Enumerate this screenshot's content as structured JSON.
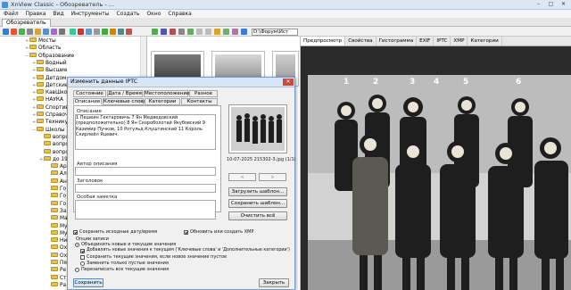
{
  "window": {
    "title": "XnView Classic - Обозреватель - ..."
  },
  "menu": [
    "Файл",
    "Правка",
    "Вид",
    "Инструменты",
    "Создать",
    "Окно",
    "Справка"
  ],
  "doc_tab": "Обозреватель",
  "path_field": "D:\\Форум\\Ист",
  "tree": [
    {
      "indent": 3,
      "exp": "+",
      "label": "Мосты"
    },
    {
      "indent": 3,
      "exp": "+",
      "label": "Область"
    },
    {
      "indent": 3,
      "exp": "−",
      "label": "Образование"
    },
    {
      "indent": 4,
      "exp": "+",
      "label": "Водный"
    },
    {
      "indent": 4,
      "exp": "+",
      "label": "Высшие"
    },
    {
      "indent": 4,
      "exp": "+",
      "label": "Детдом"
    },
    {
      "indent": 4,
      "exp": "+",
      "label": "Детские"
    },
    {
      "indent": 4,
      "exp": "+",
      "label": "КавШкол"
    },
    {
      "indent": 4,
      "exp": "+",
      "label": "НАУКА"
    },
    {
      "indent": 4,
      "exp": "+",
      "label": "Спортив"
    },
    {
      "indent": 4,
      "exp": "+",
      "label": "Справоч"
    },
    {
      "indent": 4,
      "exp": "+",
      "label": "Техникум"
    },
    {
      "indent": 4,
      "exp": "−",
      "label": "Школы"
    },
    {
      "indent": 5,
      "exp": "",
      "label": "вопрос"
    },
    {
      "indent": 5,
      "exp": "",
      "label": "вопрос"
    },
    {
      "indent": 5,
      "exp": "",
      "label": "вопрос"
    },
    {
      "indent": 5,
      "exp": "+",
      "label": "до 19"
    },
    {
      "indent": 6,
      "exp": "",
      "label": "Ар"
    },
    {
      "indent": 6,
      "exp": "",
      "label": "Ал"
    },
    {
      "indent": 6,
      "exp": "",
      "label": "Ан"
    },
    {
      "indent": 6,
      "exp": "",
      "label": "Го"
    },
    {
      "indent": 6,
      "exp": "",
      "label": "Го"
    },
    {
      "indent": 6,
      "exp": "",
      "label": "Го"
    },
    {
      "indent": 6,
      "exp": "",
      "label": "За"
    },
    {
      "indent": 6,
      "exp": "",
      "label": "Ма"
    },
    {
      "indent": 6,
      "exp": "",
      "label": "Му"
    },
    {
      "indent": 6,
      "exp": "",
      "label": "Му"
    },
    {
      "indent": 6,
      "exp": "",
      "label": "Ни"
    },
    {
      "indent": 6,
      "exp": "",
      "label": "Ох"
    },
    {
      "indent": 6,
      "exp": "",
      "label": "Ох"
    },
    {
      "indent": 6,
      "exp": "",
      "label": "Пя"
    },
    {
      "indent": 6,
      "exp": "",
      "label": "Ре"
    },
    {
      "indent": 6,
      "exp": "",
      "label": "Ст"
    },
    {
      "indent": 6,
      "exp": "",
      "label": "Ра"
    }
  ],
  "preview_tabs": [
    "Предпросмотр",
    "Свойства",
    "Гистограмма",
    "EXIF",
    "IPTC",
    "XMP",
    "Категории"
  ],
  "photo_numbers": [
    "1",
    "2",
    "3",
    "4",
    "5",
    "6"
  ],
  "dialog": {
    "title": "Изменить данные IPTC",
    "tabs_row1": [
      "Состояние",
      "Дата / Время",
      "Местоположение",
      "Разное"
    ],
    "tabs_row2": [
      "Описание",
      "Ключевые слова",
      "Категории",
      "Контакты"
    ],
    "field_description_label": "Описание",
    "description_text": "1 Пешеин Гектаровичь 7 Ян Медведовский (предположительно) 8 Ян Скороболотай Якубовский 9 Казимир Пучков, 10 Ротульд Клуштинский 11 Король Скирлейл Яцевич.",
    "field_author_label": "Автор описания",
    "field_heading_label": "Заголовок",
    "field_special_label": "Особая заметка",
    "filename": "10-07-2025 215302-3.jpg (1/1)",
    "nav_prev": "<",
    "nav_next": ">",
    "btn_load": "Загрузить шаблон...",
    "btn_save_tpl": "Сохранить шаблон...",
    "btn_clear": "Очистить всё",
    "chk_keep_dates": "Сохранить исходные дату/время",
    "chk_update_xmp": "Обновить или создать XMP",
    "write_options_label": "Опции записи",
    "opt_merge": "Объединить новые и текущие значения",
    "opt_add_keywords": "Добавлять новые значения к текущим ('Ключевые слова' и 'Дополнительные категории')",
    "opt_keep_current": "Сохранить текущие значения, если новое значение пустое",
    "opt_replace_empty": "Заменить только пустые значения",
    "opt_overwrite": "Перезаписать все текущие значения",
    "btn_save": "Сохранить",
    "btn_close": "Закрыть"
  },
  "colors": {
    "accent": "#d7e5f5",
    "close": "#c84b3c",
    "folder": "#e8c04a"
  }
}
